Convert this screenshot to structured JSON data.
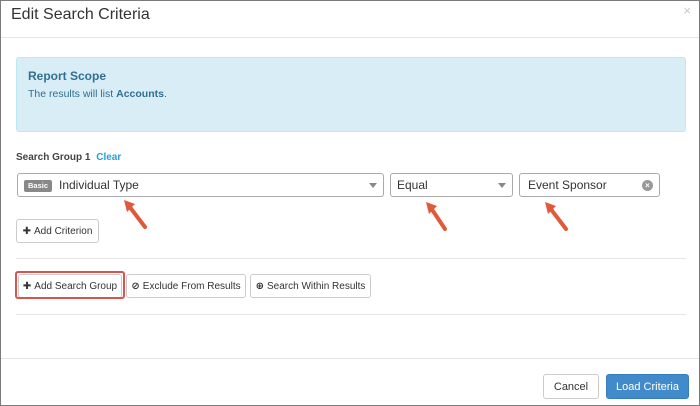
{
  "modal": {
    "title": "Edit Search Criteria",
    "close_glyph": "×"
  },
  "report_scope": {
    "title": "Report Scope",
    "text_prefix": "The results will list",
    "entity": "Accounts",
    "text_suffix": "."
  },
  "search_group": {
    "label": "Search Group 1",
    "clear_label": "Clear",
    "criterion": {
      "badge": "Basic",
      "field": "Individual Type",
      "operator": "Equal",
      "value": "Event Sponsor",
      "clear_glyph": "×"
    },
    "add_criterion_label": "Add Criterion"
  },
  "group_actions": {
    "add_search_group_label": "Add Search Group",
    "exclude_label": "Exclude From Results",
    "search_within_label": "Search Within Results"
  },
  "footer": {
    "cancel_label": "Cancel",
    "load_label": "Load Criteria"
  },
  "colors": {
    "primary": "#428bca",
    "info_bg": "#d9edf7",
    "info_text": "#31708f",
    "annotation_red": "#e05a3a",
    "highlight_border": "#d9534f",
    "link": "#2a9fd6"
  },
  "icons": {
    "add_criterion": "plus-icon",
    "add_search_group": "plus-icon",
    "exclude": "ban-icon",
    "search_within": "zoom-in-icon",
    "annotation": "red-arrow-icon"
  }
}
